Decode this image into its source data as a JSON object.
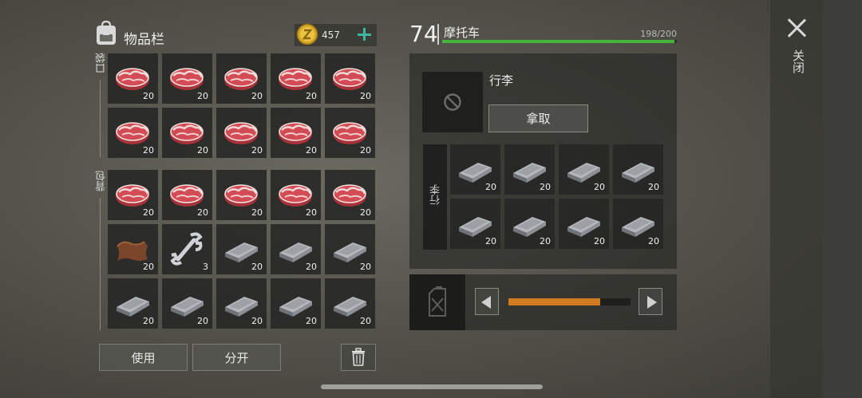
{
  "close": {
    "label": "关闭",
    "icon": "close-x-icon"
  },
  "inventory": {
    "title": "物品栏",
    "coins": "457",
    "pocket_label": "口袋",
    "backpack_label": "背包",
    "pockets": [
      {
        "item": "raw-meat",
        "count": "20"
      },
      {
        "item": "raw-meat",
        "count": "20"
      },
      {
        "item": "raw-meat",
        "count": "20"
      },
      {
        "item": "raw-meat",
        "count": "20"
      },
      {
        "item": "raw-meat",
        "count": "20"
      },
      {
        "item": "raw-meat",
        "count": "20"
      },
      {
        "item": "raw-meat",
        "count": "20"
      },
      {
        "item": "raw-meat",
        "count": "20"
      },
      {
        "item": "raw-meat",
        "count": "20"
      },
      {
        "item": "raw-meat",
        "count": "20"
      }
    ],
    "backpack": [
      {
        "item": "raw-meat",
        "count": "20"
      },
      {
        "item": "raw-meat",
        "count": "20"
      },
      {
        "item": "raw-meat",
        "count": "20"
      },
      {
        "item": "raw-meat",
        "count": "20"
      },
      {
        "item": "raw-meat",
        "count": "20"
      },
      {
        "item": "leather",
        "count": "20"
      },
      {
        "item": "wrench",
        "count": "3"
      },
      {
        "item": "iron-bar",
        "count": "20"
      },
      {
        "item": "iron-bar",
        "count": "20"
      },
      {
        "item": "iron-bar",
        "count": "20"
      },
      {
        "item": "iron-bar",
        "count": "20"
      },
      {
        "item": "iron-bar",
        "count": "20"
      },
      {
        "item": "iron-bar",
        "count": "20"
      },
      {
        "item": "iron-bar",
        "count": "20"
      },
      {
        "item": "iron-bar",
        "count": "20"
      }
    ],
    "use_label": "使用",
    "split_label": "分开"
  },
  "vehicle": {
    "level": "74",
    "name": "摩托车",
    "durability": "198/200",
    "durability_fraction": 0.99,
    "equip_label": "行李",
    "take_label": "拿取",
    "trunk_label": "行李",
    "trunk": [
      {
        "item": "iron-bar",
        "count": "20"
      },
      {
        "item": "iron-bar",
        "count": "20"
      },
      {
        "item": "iron-bar",
        "count": "20"
      },
      {
        "item": "iron-bar",
        "count": "20"
      },
      {
        "item": "iron-bar",
        "count": "20"
      },
      {
        "item": "iron-bar",
        "count": "20"
      },
      {
        "item": "iron-bar",
        "count": "20"
      },
      {
        "item": "iron-bar",
        "count": "20"
      }
    ],
    "fuel_fraction": 0.75
  },
  "colors": {
    "durability_bar": "#45b43b",
    "fuel_bar": "#cf7b22",
    "coin_plus": "#3fb7a0"
  }
}
